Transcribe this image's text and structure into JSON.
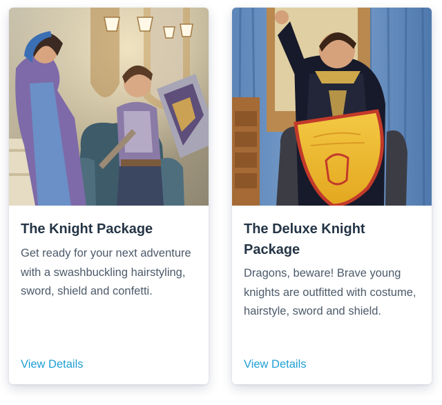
{
  "cards": [
    {
      "title": "The Knight Package",
      "description": "Get ready for your next adventure with a swashbuckling hairstyling, sword, shield and confetti.",
      "link_label": "View Details"
    },
    {
      "title": "The Deluxe Knight Package",
      "description": "Dragons, beware! Brave young knights are outfitted with costume, hairstyle, sword and shield.",
      "link_label": "View Details"
    }
  ],
  "colors": {
    "title_text": "#243445",
    "body_text": "#4c5a6a",
    "link": "#1f9fd4"
  }
}
